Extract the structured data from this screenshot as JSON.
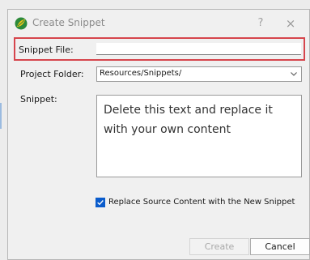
{
  "window": {
    "title": "Create Snippet",
    "help_glyph": "?",
    "close_glyph": "×"
  },
  "form": {
    "snippet_file_label": "Snippet File:",
    "snippet_file_value": "",
    "project_folder_label": "Project Folder:",
    "project_folder_value": "Resources/Snippets/",
    "snippet_label": "Snippet:",
    "snippet_text": "Delete this text and replace it with your own content",
    "replace_checkbox_label": "Replace Source Content with the New Snippet",
    "replace_checked": true
  },
  "buttons": {
    "create_label": "Create",
    "create_enabled": false,
    "cancel_label": "Cancel"
  },
  "colors": {
    "highlight": "#d6454c",
    "checkbox": "#0a5ccc"
  }
}
